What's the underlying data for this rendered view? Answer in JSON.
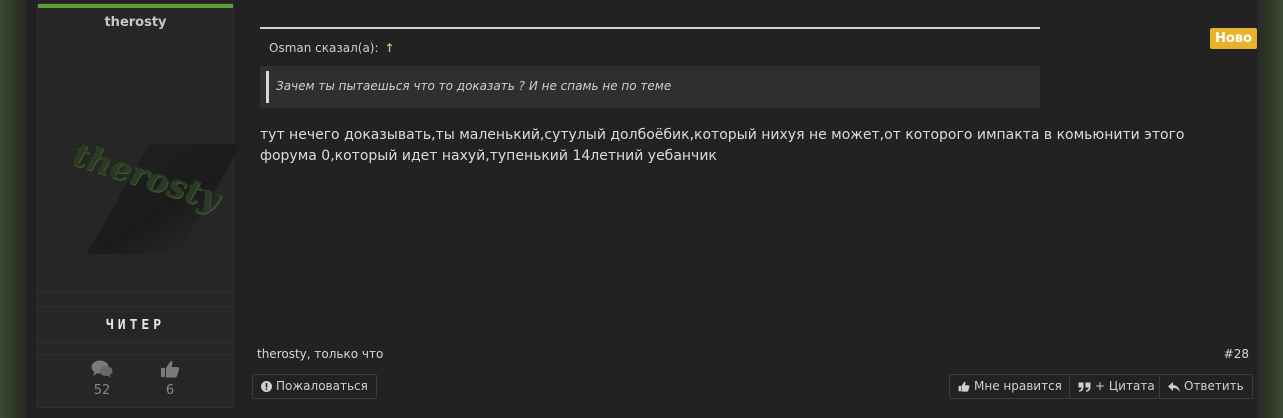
{
  "user": {
    "name": "therosty",
    "avatar_text": "therosty",
    "rank": "ЧИТЕР",
    "stats": {
      "messages": "52",
      "likes": "6"
    }
  },
  "quote": {
    "author": "Osman сказал(а):",
    "arrow": "↑",
    "text": "Зачем ты пытаешься что то доказать ? И не спамь не по теме"
  },
  "message": {
    "text": "тут нечего доказывать,ты маленький,сутулый долбоёбик,который нихуя не может,от которого импакта в комьюнити этого форума 0,который идет нахуй,тупенький 14летний уебанчик"
  },
  "badge": {
    "label": "Ново"
  },
  "meta": {
    "author_time": "therosty, только что",
    "post_number": "#28"
  },
  "actions": {
    "report": "Пожаловаться",
    "like": "Мне нравится",
    "quote": "+ Цитата",
    "reply": "Ответить"
  },
  "colors": {
    "accent_green": "#5d9e36",
    "badge": "#e8b32c",
    "quote_arrow": "#9ad06a"
  }
}
